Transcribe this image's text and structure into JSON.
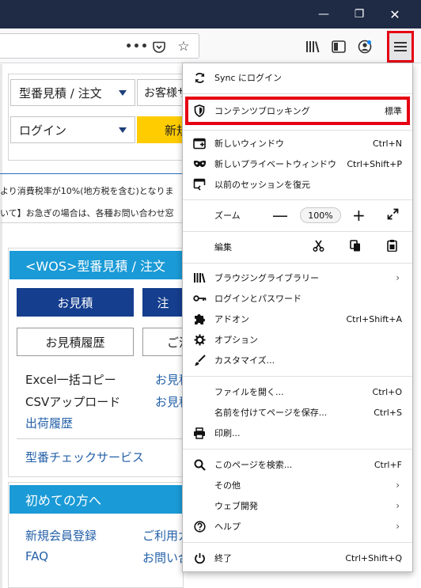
{
  "window": {
    "minimize": "—",
    "maximize": "❐",
    "close": "✕"
  },
  "toolbar": {
    "icons": [
      "page-actions-icon",
      "pocket-icon",
      "bookmark-star-icon",
      "library-icon",
      "sidebar-icon",
      "account-icon",
      "hamburger-menu-icon"
    ]
  },
  "page": {
    "model_select": "型番見積 / 注文",
    "customer_box": "お客様サ",
    "login_select": "ログイン",
    "new_button": "新規",
    "notice1": "より消費税率が10%(地方税を含む)となりま",
    "notice2": "いて】お急ぎの場合は、各種お問い合わせ窓",
    "wos_panel": {
      "title": "<WOS>型番見積 / 注文",
      "quote_btn": "お見積",
      "order_btn": "注",
      "history_btn": "お見積履歴",
      "history2_btn": "ご注",
      "excel": "Excel一括コピー",
      "csv": "CSVアップロード",
      "shipping": "出荷履歴",
      "est_link1": "お見積",
      "est_link2": "お見積",
      "check_service": "型番チェックサービス"
    },
    "first_panel": {
      "title": "初めての方へ",
      "register": "新規会員登録",
      "guide": "ご利用ガ",
      "faq": "FAQ",
      "contact": "お問い合"
    }
  },
  "menu": {
    "sync": "Sync にログイン",
    "content_blocking": "コンテンツブロッキング",
    "content_blocking_value": "標準",
    "new_window": "新しいウィンドウ",
    "new_window_key": "Ctrl+N",
    "new_private": "新しいプライベートウィンドウ",
    "new_private_key": "Ctrl+Shift+P",
    "restore_session": "以前のセッションを復元",
    "zoom": "ズーム",
    "zoom_minus": "—",
    "zoom_value": "100%",
    "zoom_plus": "+",
    "edit": "編集",
    "library": "ブラウジングライブラリー",
    "logins": "ログインとパスワード",
    "addons": "アドオン",
    "addons_key": "Ctrl+Shift+A",
    "options": "オプション",
    "customize": "カスタマイズ...",
    "open_file": "ファイルを開く...",
    "open_file_key": "Ctrl+O",
    "save_page": "名前を付けてページを保存...",
    "save_page_key": "Ctrl+S",
    "print": "印刷...",
    "find": "このページを検索...",
    "find_key": "Ctrl+F",
    "more": "その他",
    "web_dev": "ウェブ開発",
    "help": "ヘルプ",
    "quit": "終了",
    "quit_key": "Ctrl+Shift+Q"
  },
  "colors": {
    "highlight": "#e60012",
    "titlebar": "#1f2a44",
    "panel_blue": "#1a9ad6",
    "button_navy": "#153e8e",
    "new_button_yellow": "#ffcc00"
  }
}
